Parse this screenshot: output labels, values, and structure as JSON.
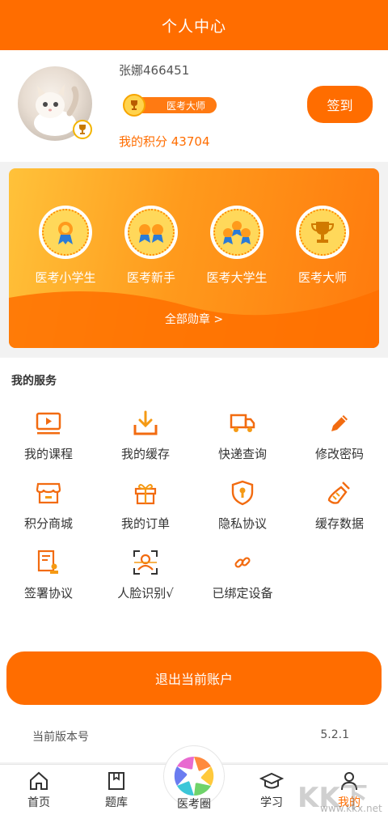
{
  "header": {
    "title": "个人中心"
  },
  "profile": {
    "username": "张娜466451",
    "level": "医考大师",
    "points": "我的积分 43704",
    "checkin_label": "签到"
  },
  "badges": {
    "items": [
      {
        "label": "医考小学生",
        "icon": "ribbon-medal-icon"
      },
      {
        "label": "医考新手",
        "icon": "double-ribbon-medal-icon"
      },
      {
        "label": "医考大学生",
        "icon": "triple-ribbon-medal-icon"
      },
      {
        "label": "医考大师",
        "icon": "trophy-icon"
      }
    ],
    "all_label": "全部勋章 >"
  },
  "services": {
    "title": "我的服务",
    "items": [
      {
        "label": "我的课程",
        "icon": "video-course-icon"
      },
      {
        "label": "我的缓存",
        "icon": "download-icon"
      },
      {
        "label": "快递查询",
        "icon": "truck-icon"
      },
      {
        "label": "修改密码",
        "icon": "pencil-icon"
      },
      {
        "label": "积分商城",
        "icon": "store-icon"
      },
      {
        "label": "我的订单",
        "icon": "gift-icon"
      },
      {
        "label": "隐私协议",
        "icon": "shield-lock-icon"
      },
      {
        "label": "缓存数据",
        "icon": "broom-icon"
      },
      {
        "label": "签署协议",
        "icon": "document-stamp-icon"
      },
      {
        "label": "人脸识别√",
        "icon": "face-scan-icon"
      },
      {
        "label": "已绑定设备",
        "icon": "link-icon"
      }
    ]
  },
  "logout_label": "退出当前账户",
  "version": {
    "label": "当前版本号",
    "value": "5.2.1"
  },
  "tabbar": {
    "items": [
      {
        "label": "首页",
        "icon": "home-icon"
      },
      {
        "label": "题库",
        "icon": "book-icon"
      },
      {
        "label": "医考圈",
        "icon": "aperture-icon"
      },
      {
        "label": "学习",
        "icon": "graduation-cap-icon"
      },
      {
        "label": "我的",
        "icon": "person-icon"
      }
    ],
    "active": "我的"
  },
  "watermark": {
    "text": "KK下载",
    "url": "www.kkx.net"
  },
  "colors": {
    "accent": "#ff6d00",
    "gold": "#ffd85a"
  }
}
